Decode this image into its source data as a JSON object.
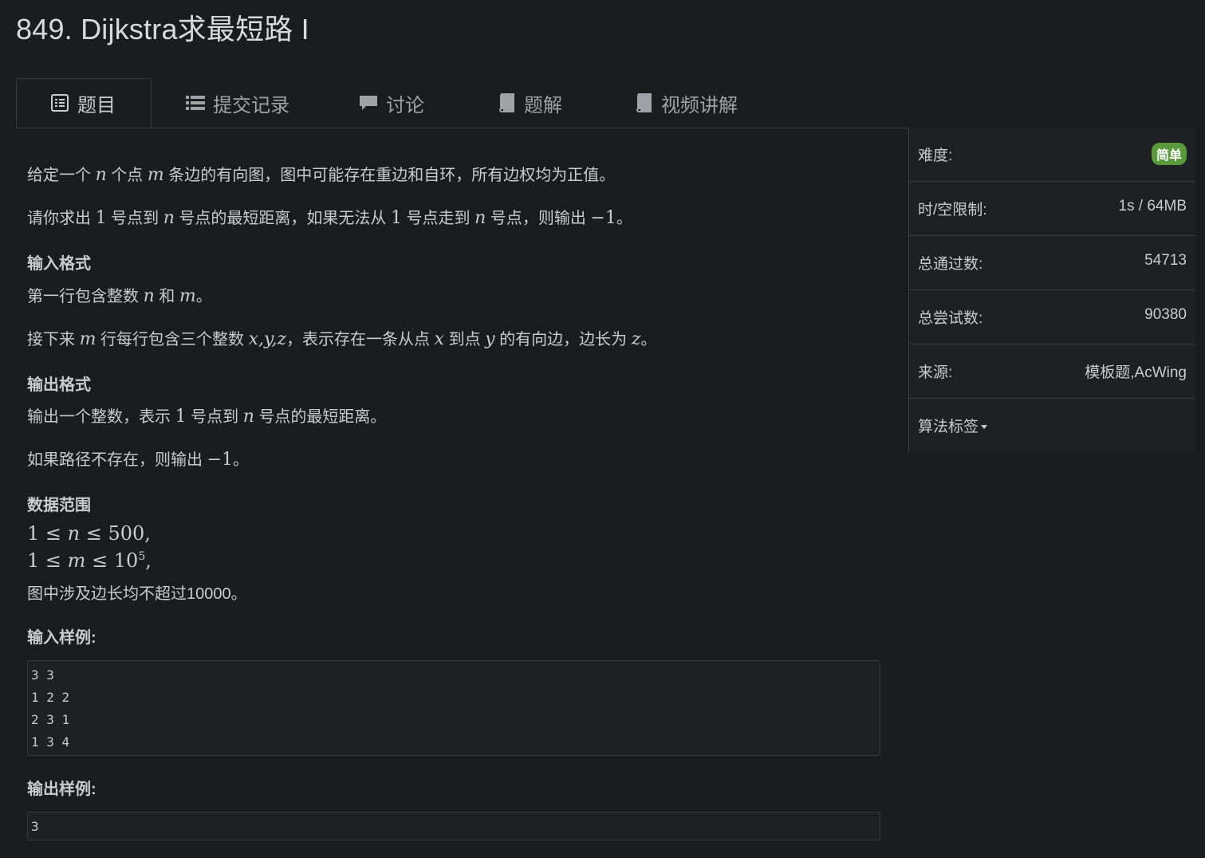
{
  "title": "849. Dijkstra求最短路 I",
  "tabs": [
    {
      "label": "题目",
      "icon": "list-alt-icon",
      "active": true
    },
    {
      "label": "提交记录",
      "icon": "list-icon",
      "active": false
    },
    {
      "label": "讨论",
      "icon": "comment-icon",
      "active": false
    },
    {
      "label": "题解",
      "icon": "book-icon",
      "active": false
    },
    {
      "label": "视频讲解",
      "icon": "book-icon",
      "active": false
    }
  ],
  "problem": {
    "desc1": {
      "a": "给定一个 ",
      "n": "n",
      "b": " 个点 ",
      "m": "m",
      "c": " 条边的有向图，图中可能存在重边和自环，所有边权均为正值。"
    },
    "desc2": {
      "a": "请你求出 ",
      "one": "1",
      "b": " 号点到 ",
      "n": "n",
      "c": " 号点的最短距离，如果无法从 ",
      "one2": "1",
      "d": " 号点走到 ",
      "n2": "n",
      "e": " 号点，则输出 ",
      "neg": "−1",
      "f": "。"
    },
    "input_heading": "输入格式",
    "input1": {
      "a": "第一行包含整数 ",
      "n": "n",
      "b": " 和 ",
      "m": "m",
      "c": "。"
    },
    "input2": {
      "a": "接下来 ",
      "m": "m",
      "b": " 行每行包含三个整数 ",
      "xyz": "x,y,z",
      "c": "，表示存在一条从点 ",
      "x": "x",
      "d": " 到点 ",
      "y": "y",
      "e": " 的有向边，边长为 ",
      "z": "z",
      "f": "。"
    },
    "output_heading": "输出格式",
    "output1": {
      "a": "输出一个整数，表示 ",
      "one": "1",
      "b": " 号点到 ",
      "n": "n",
      "c": " 号点的最短距离。"
    },
    "output2": {
      "a": "如果路径不存在，则输出 ",
      "neg": "−1",
      "b": "。"
    },
    "range_heading": "数据范围",
    "range1": {
      "a": "1 ≤ ",
      "n": "n",
      "b": " ≤ 500,"
    },
    "range2": {
      "a": "1 ≤ ",
      "m": "m",
      "b": " ≤ 10",
      "sup": "5",
      "c": ","
    },
    "range3": "图中涉及边长均不超过10000。",
    "sample_in_heading": "输入样例:",
    "sample_in": [
      "3 3",
      "1 2 2",
      "2 3 1",
      "1 3 4"
    ],
    "sample_out_heading": "输出样例:",
    "sample_out": [
      "3"
    ]
  },
  "sidebar": {
    "difficulty_label": "难度:",
    "difficulty_value": "简单",
    "difficulty_color": "#5a9a3c",
    "limit_label": "时/空限制:",
    "limit_value": "1s / 64MB",
    "passed_label": "总通过数:",
    "passed_value": "54713",
    "tried_label": "总尝试数:",
    "tried_value": "90380",
    "source_label": "来源:",
    "source_value": "模板题,AcWing",
    "tags_label": "算法标签"
  }
}
